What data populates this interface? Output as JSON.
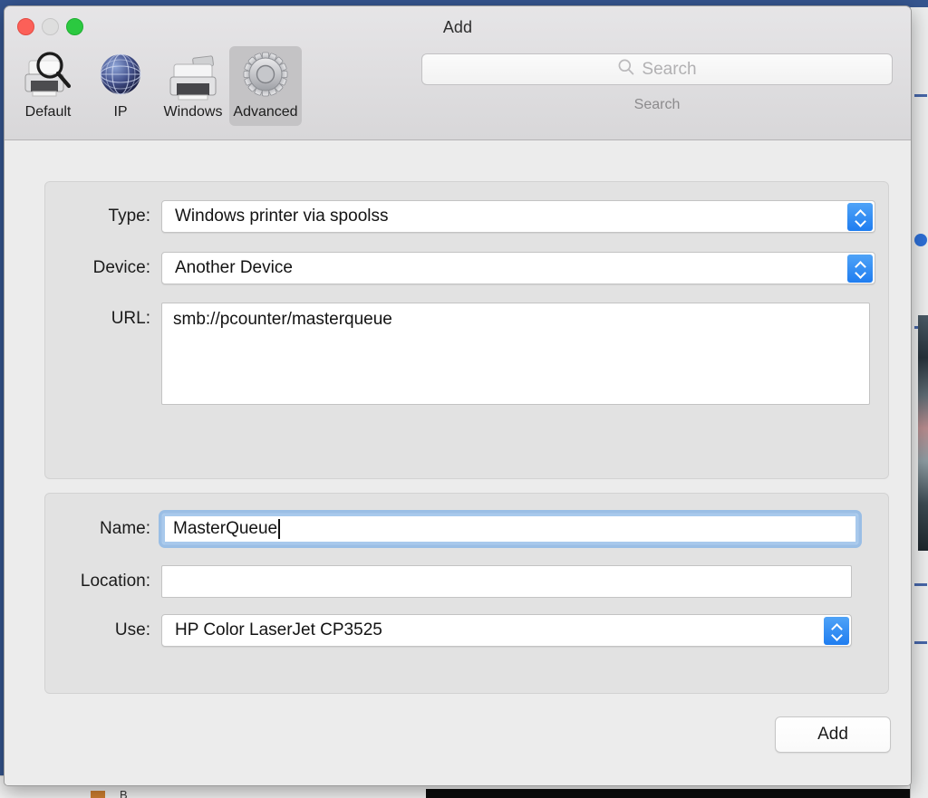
{
  "window": {
    "title": "Add",
    "traffic_lights": [
      {
        "name": "close",
        "color": "#fc6058"
      },
      {
        "name": "minimize",
        "color": "#dedede"
      },
      {
        "name": "zoom",
        "color": "#2bc940"
      }
    ]
  },
  "toolbar": {
    "tabs": [
      {
        "label": "Default",
        "icon": "printer-search-icon",
        "selected": false
      },
      {
        "label": "IP",
        "icon": "globe-icon",
        "selected": false
      },
      {
        "label": "Windows",
        "icon": "printer-icon",
        "selected": false
      },
      {
        "label": "Advanced",
        "icon": "gear-icon",
        "selected": true
      }
    ],
    "search": {
      "icon": "search-icon",
      "placeholder": "Search",
      "value": "",
      "caption": "Search"
    }
  },
  "connection_panel": {
    "type": {
      "label": "Type:",
      "value": "Windows printer via spoolss"
    },
    "device": {
      "label": "Device:",
      "value": "Another Device"
    },
    "url": {
      "label": "URL:",
      "value": "smb://pcounter/masterqueue"
    }
  },
  "identity_panel": {
    "name": {
      "label": "Name:",
      "value": "MasterQueue",
      "focused": true
    },
    "location": {
      "label": "Location:",
      "value": "",
      "placeholder": ""
    },
    "use": {
      "label": "Use:",
      "value": "HP Color LaserJet CP3525"
    }
  },
  "footer": {
    "add_label": "Add"
  },
  "colors": {
    "accent_blue": "#2f7df0",
    "window_chrome": "#ececec",
    "panel": "#e2e2e2",
    "focus_ring": "#a8c9ec",
    "desktop": "#35558f"
  }
}
